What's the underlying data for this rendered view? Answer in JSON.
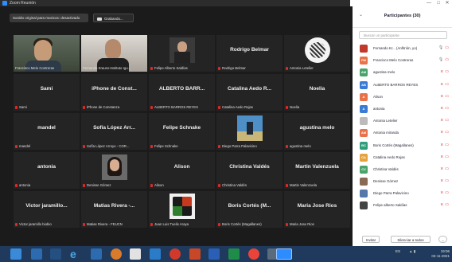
{
  "window": {
    "title": "Zoom Reunión",
    "minimize": "—",
    "maximize": "□",
    "close": "✕"
  },
  "toolbar": {
    "original_sound": "Sonido original para musicos: desactivado",
    "recording": "Grabando..."
  },
  "tiles": [
    {
      "name": "",
      "label": "Francisco Melo Contreras"
    },
    {
      "name": "",
      "label": "Fernando Krauss-Instituto Igu..."
    },
    {
      "name": "",
      "label": "Felipe Alberto Saldías"
    },
    {
      "name": "Rodrigo Belmar",
      "label": "Rodrigo Belmar"
    },
    {
      "name": "",
      "label": "Antonia Letelier"
    },
    {
      "name": "Sami",
      "label": "Sami"
    },
    {
      "name": "iPhone de Const...",
      "label": "iPhone de Constanza"
    },
    {
      "name": "ALBERTO BARR...",
      "label": "ALBERTO BARROS REYES"
    },
    {
      "name": "Catalina Aedo R...",
      "label": "Catalina Aedo Rojas"
    },
    {
      "name": "Noelia",
      "label": "Noelia"
    },
    {
      "name": "mandel",
      "label": "mandel"
    },
    {
      "name": "Sofía López Arr...",
      "label": "Sofía López Arroyo - COR..."
    },
    {
      "name": "Felipe Schnake",
      "label": "Felipe Schnake"
    },
    {
      "name": "",
      "label": "Diego Parra Palavicino"
    },
    {
      "name": "agustina melo",
      "label": "agustina melo"
    },
    {
      "name": "antonia",
      "label": "antonia"
    },
    {
      "name": "",
      "label": "Denisse Gómez"
    },
    {
      "name": "Alison",
      "label": "Alison"
    },
    {
      "name": "Christina Valdés",
      "label": "Christina Valdés"
    },
    {
      "name": "Martin Valenzuela",
      "label": "Martin Valenzuela"
    },
    {
      "name": "Victor jaramillo...",
      "label": "Victor jaramillo biobio"
    },
    {
      "name": "Matias Rivera -...",
      "label": "Matias Rivera - FEUCN"
    },
    {
      "name": "",
      "label": "Juan Luis Tuelis Araya"
    },
    {
      "name": "Boris Cortés (M...",
      "label": "Boris Cortés (Magallanes)"
    },
    {
      "name": "Maria Jose Rios",
      "label": "Maria Jose Rios"
    }
  ],
  "participants": {
    "title": "Participantes (30)",
    "collapse_icon": "⌄",
    "search_placeholder": "Buscar un participante",
    "items": [
      {
        "name": "Fernando Kr... (Anfitrión, yo)",
        "initials": "",
        "color": "#c0392b",
        "host": true
      },
      {
        "name": "Francisco Melo Contreras",
        "initials": "FM",
        "color": "#e8734a",
        "host": false
      },
      {
        "name": "agustina melo",
        "initials": "AM",
        "color": "#4aa36b",
        "host": false
      },
      {
        "name": "ALBERTO BARROS REYES",
        "initials": "AB",
        "color": "#3a7bd5",
        "host": false
      },
      {
        "name": "Alison",
        "initials": "A",
        "color": "#e8734a",
        "host": false
      },
      {
        "name": "antonia",
        "initials": "A",
        "color": "#3a7bd5",
        "host": false
      },
      {
        "name": "Antonia Letelier",
        "initials": "",
        "color": "#bbbbbb",
        "host": false
      },
      {
        "name": "Antonia miranda",
        "initials": "AM",
        "color": "#e8734a",
        "host": false
      },
      {
        "name": "Boris Cortés (Magallanes)",
        "initials": "BC",
        "color": "#2f9e7a",
        "host": false
      },
      {
        "name": "Catalina Aedo Rojas",
        "initials": "CA",
        "color": "#e6a23c",
        "host": false
      },
      {
        "name": "Christina Valdés",
        "initials": "CV",
        "color": "#4aa36b",
        "host": false
      },
      {
        "name": "Denisse Gómez",
        "initials": "",
        "color": "#8a6a55",
        "host": false
      },
      {
        "name": "Diego Parra Palavicino",
        "initials": "",
        "color": "#5577aa",
        "host": false
      },
      {
        "name": "Felipe alberto Saldías",
        "initials": "",
        "color": "#444444",
        "host": false
      }
    ],
    "invite": "Invitar",
    "mute_all": "Silenciar a todos",
    "more": "..."
  },
  "taskbar": {
    "time": "19:06",
    "date": "02-11-2021",
    "lang": "ES"
  }
}
